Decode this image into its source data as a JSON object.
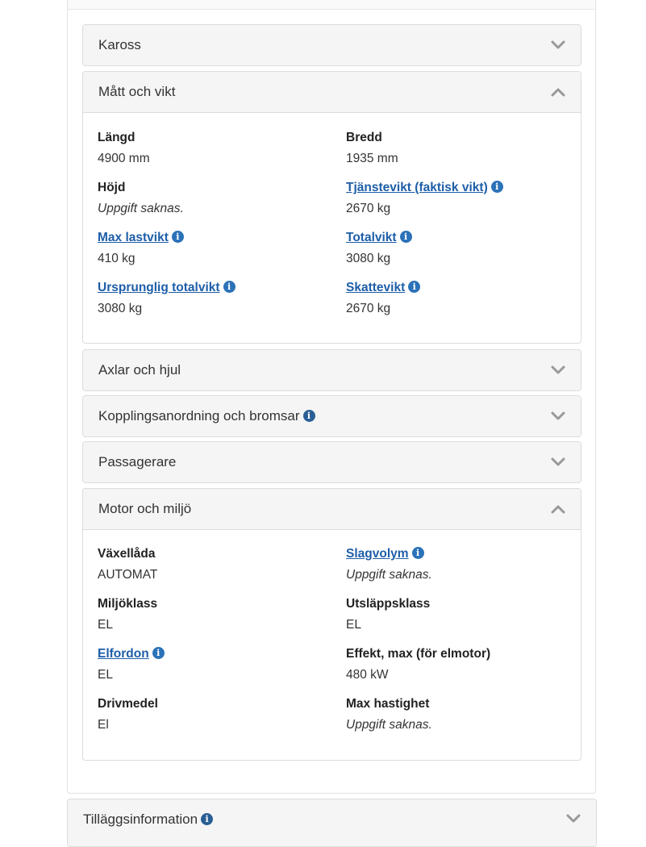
{
  "sections": {
    "kaross": {
      "title": "Kaross"
    },
    "matt_och_vikt": {
      "title": "Mått och vikt",
      "fields": {
        "langd": {
          "label": "Längd",
          "value": "4900 mm"
        },
        "bredd": {
          "label": "Bredd",
          "value": "1935 mm"
        },
        "hojd": {
          "label": "Höjd",
          "value": "Uppgift saknas."
        },
        "tjanstevikt": {
          "label": "Tjänstevikt (faktisk vikt)",
          "value": "2670 kg"
        },
        "max_lastvikt": {
          "label": "Max lastvikt",
          "value": "410 kg"
        },
        "totalvikt": {
          "label": "Totalvikt",
          "value": "3080 kg"
        },
        "ursprunglig_totalvikt": {
          "label": "Ursprunglig totalvikt",
          "value": "3080 kg"
        },
        "skattevikt": {
          "label": "Skattevikt",
          "value": "2670 kg"
        }
      }
    },
    "axlar_och_hjul": {
      "title": "Axlar och hjul"
    },
    "kopplingsanordning": {
      "title": "Kopplingsanordning och bromsar"
    },
    "passagerare": {
      "title": "Passagerare"
    },
    "motor_och_miljo": {
      "title": "Motor och miljö",
      "fields": {
        "vaxellada": {
          "label": "Växellåda",
          "value": "AUTOMAT"
        },
        "slagvolym": {
          "label": "Slagvolym",
          "value": "Uppgift saknas."
        },
        "miljoklass": {
          "label": "Miljöklass",
          "value": "EL"
        },
        "utslappsklass": {
          "label": "Utsläppsklass",
          "value": "EL"
        },
        "elfordon": {
          "label": "Elfordon",
          "value": "EL"
        },
        "effekt_max": {
          "label": "Effekt, max (för elmotor)",
          "value": "480 kW"
        },
        "drivmedel": {
          "label": "Drivmedel",
          "value": "El"
        },
        "max_hastighet": {
          "label": "Max hastighet",
          "value": "Uppgift saknas."
        }
      }
    },
    "tillaggsinformation": {
      "title": "Tilläggsinformation"
    }
  },
  "icons": {
    "info": "i",
    "chevron_down": "chevron-down-icon",
    "chevron_up": "chevron-up-icon"
  },
  "colors": {
    "link": "#1e5ea8",
    "info_icon": "#2b72b8",
    "panel_header_bg": "#f5f5f5",
    "border": "#dcdcdc"
  }
}
